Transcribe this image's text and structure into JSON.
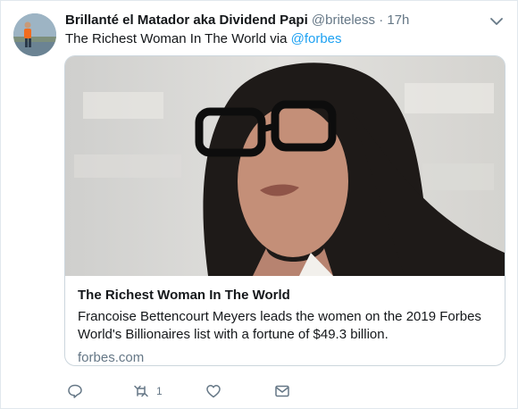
{
  "author": {
    "display_name": "Brillanté el Matador aka Dividend Papi",
    "handle": "@briteless",
    "separator": "·",
    "timestamp": "17h"
  },
  "tweet": {
    "text": "The Richest Woman In The World  via ",
    "via_handle": "@forbes"
  },
  "card": {
    "title": "The Richest Woman In The World",
    "description": "Francoise Bettencourt Meyers leads the women on the 2019 Forbes World's Billionaires list with a fortune of $49.3 billion.",
    "domain": "forbes.com"
  },
  "actions": {
    "reply_icon": "reply-icon",
    "retweet_icon": "retweet-icon",
    "retweet_count": "1",
    "like_icon": "heart-icon",
    "dm_icon": "envelope-icon"
  },
  "colors": {
    "link": "#1da1f2",
    "muted": "#657786",
    "text": "#14171a",
    "border": "#ccd6dd"
  }
}
